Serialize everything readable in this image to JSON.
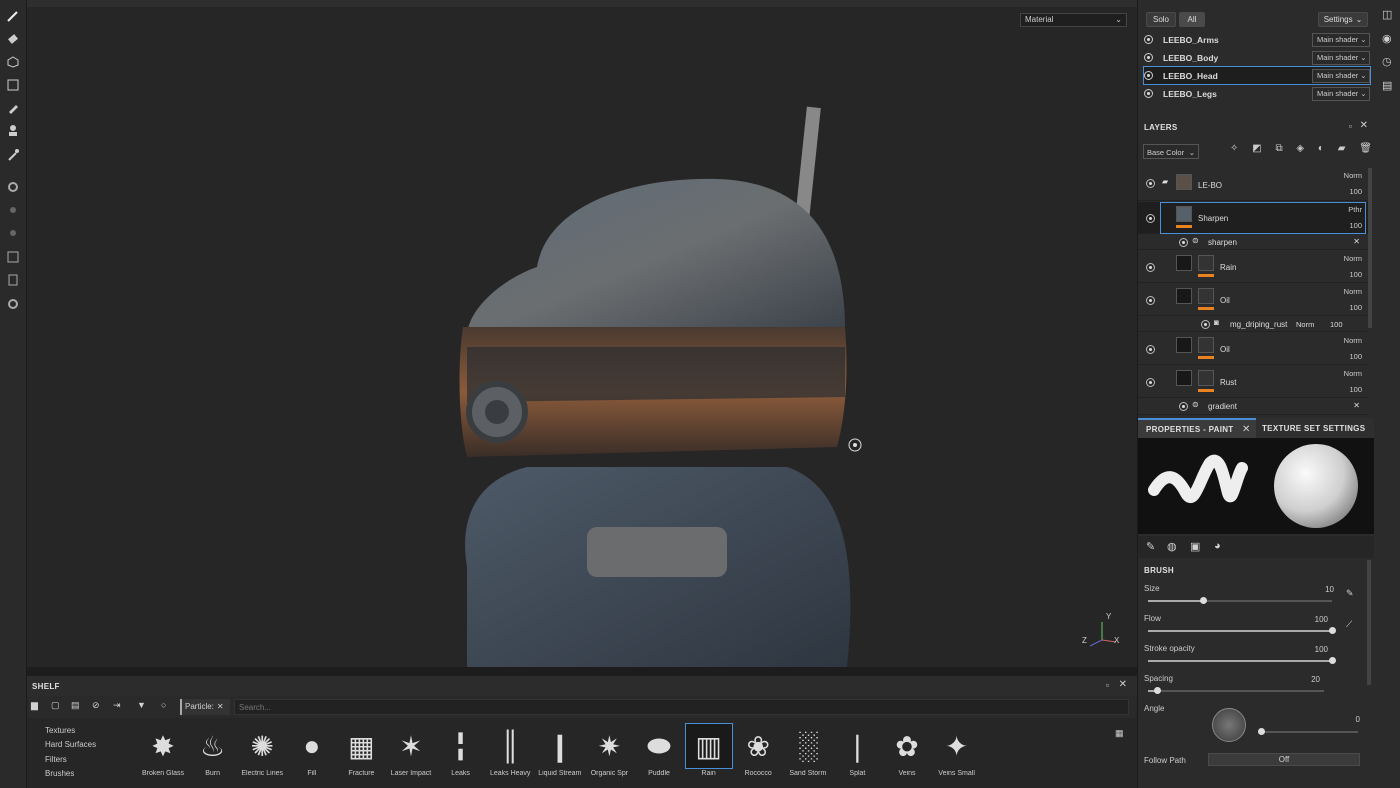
{
  "viewport": {
    "shading_mode": "Material",
    "axis_labels": {
      "x": "X",
      "y": "Y",
      "z": "Z"
    }
  },
  "texture_sets": {
    "solo": "Solo",
    "all": "All",
    "settings": "Settings",
    "items": [
      {
        "name": "LEEBO_Arms",
        "shader": "Main shader"
      },
      {
        "name": "LEEBO_Body",
        "shader": "Main shader"
      },
      {
        "name": "LEEBO_Head",
        "shader": "Main shader"
      },
      {
        "name": "LEEBO_Legs",
        "shader": "Main shader"
      }
    ]
  },
  "layers": {
    "title": "LAYERS",
    "channel": "Base Color",
    "items": [
      {
        "name": "LE-BO",
        "blend": "Norm",
        "opacity": "100"
      },
      {
        "name": "Sharpen",
        "blend": "Pthr",
        "opacity": "100"
      },
      {
        "name": "sharpen"
      },
      {
        "name": "Rain",
        "blend": "Norm",
        "opacity": "100"
      },
      {
        "name": "Oil",
        "blend": "Norm",
        "opacity": "100"
      },
      {
        "name": "mg_driping_rust",
        "blend": "Norm",
        "opacity": "100"
      },
      {
        "name": "Oil",
        "blend": "Norm",
        "opacity": "100"
      },
      {
        "name": "Rust",
        "blend": "Norm",
        "opacity": "100"
      },
      {
        "name": "gradient"
      }
    ]
  },
  "properties": {
    "tab_paint": "PROPERTIES - PAINT",
    "tab_texture": "TEXTURE SET SETTINGS",
    "brush_title": "BRUSH",
    "size_label": "Size",
    "size_value": "10",
    "size_fraction": 0.3,
    "flow_label": "Flow",
    "flow_value": "100",
    "flow_fraction": 1.0,
    "stroke_label": "Stroke opacity",
    "stroke_value": "100",
    "stroke_fraction": 1.0,
    "spacing_label": "Spacing",
    "spacing_value": "20",
    "spacing_fraction": 0.05,
    "angle_label": "Angle",
    "angle_value": "0",
    "follow_label": "Follow Path",
    "follow_value": "Off"
  },
  "shelf": {
    "title": "SHELF",
    "filter_chip": "Particle:",
    "search_placeholder": "Search...",
    "categories": [
      "Textures",
      "Hard Surfaces",
      "Filters",
      "Brushes"
    ],
    "items": [
      "Broken Glass",
      "Burn",
      "Electric Lines",
      "Fill",
      "Fracture",
      "Laser Impact",
      "Leaks",
      "Leaks Heavy",
      "Liquid Stream",
      "Organic Spr",
      "Puddle",
      "Rain",
      "Rococco",
      "Sand Storm",
      "Splat",
      "Veins",
      "Veins Small"
    ],
    "selected_index": 11
  }
}
